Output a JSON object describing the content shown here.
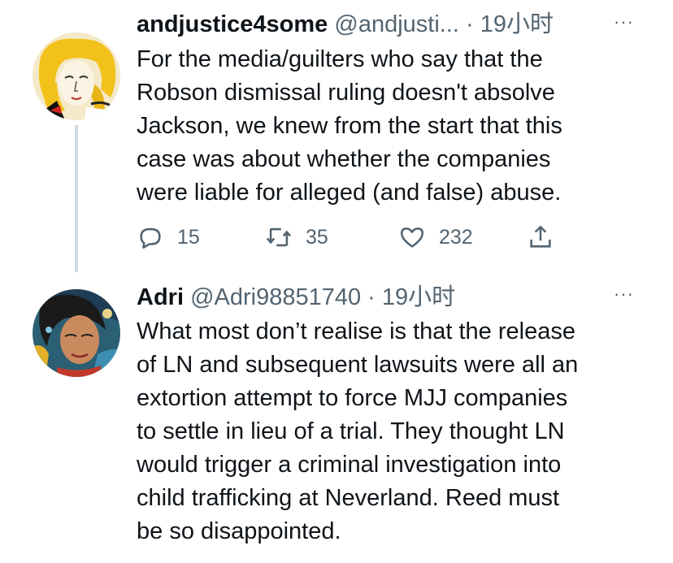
{
  "tweets": [
    {
      "display_name": "andjustice4some",
      "handle": "@andjusti...",
      "separator": "·",
      "time": "19小时",
      "more": "···",
      "text": "For the media/guilters who say that the Robson dismissal ruling doesn't absolve Jackson, we knew from the start that this case was about whether the companies were liable for alleged (and false) abuse.",
      "lines": [
        "For the media/guilters who say that the",
        "Robson dismissal ruling doesn't absolve",
        "Jackson, we knew from the start that this",
        "case was about whether the companies",
        "were liable for alleged (and false) abuse."
      ],
      "actions": {
        "reply_count": "15",
        "retweet_count": "35",
        "like_count": "232",
        "reply_icon": "reply-icon",
        "retweet_icon": "retweet-icon",
        "like_icon": "heart-icon",
        "share_icon": "share-icon"
      }
    },
    {
      "display_name": "Adri",
      "handle": "@Adri98851740",
      "separator": "·",
      "time": "19小时",
      "more": "···",
      "lines": [
        "What most don’t realise is that the release",
        "of LN and subsequent lawsuits were all an",
        "extortion attempt to force MJJ companies",
        "to settle in lieu of a trial. They thought LN",
        "would trigger a criminal investigation into",
        "child trafficking at Neverland. Reed must",
        "be so disappointed."
      ]
    }
  ],
  "colors": {
    "text": "#0f1419",
    "secondary": "#536471",
    "thread_line": "#cfd9de"
  }
}
